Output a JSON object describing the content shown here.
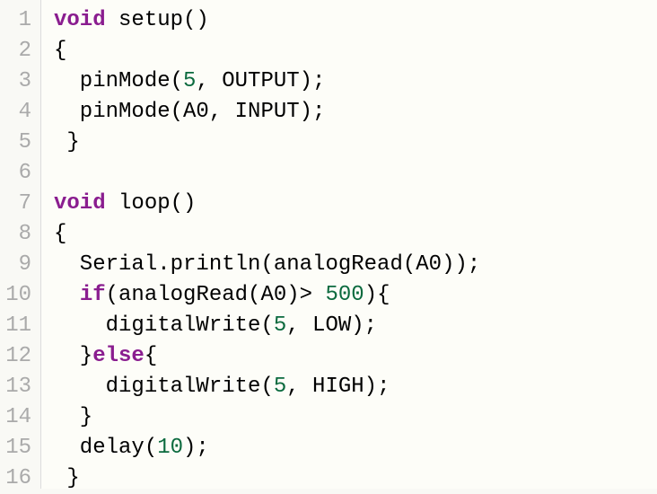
{
  "code": {
    "lines": [
      {
        "num": "1",
        "tokens": [
          {
            "t": "kw",
            "v": "void"
          },
          {
            "t": "plain",
            "v": " setup()"
          }
        ]
      },
      {
        "num": "2",
        "tokens": [
          {
            "t": "plain",
            "v": "{"
          }
        ]
      },
      {
        "num": "3",
        "tokens": [
          {
            "t": "plain",
            "v": "  pinMode("
          },
          {
            "t": "num",
            "v": "5"
          },
          {
            "t": "plain",
            "v": ", OUTPUT);"
          }
        ]
      },
      {
        "num": "4",
        "tokens": [
          {
            "t": "plain",
            "v": "  pinMode(A0, INPUT);"
          }
        ]
      },
      {
        "num": "5",
        "tokens": [
          {
            "t": "plain",
            "v": " }"
          }
        ]
      },
      {
        "num": "6",
        "tokens": [
          {
            "t": "plain",
            "v": ""
          }
        ]
      },
      {
        "num": "7",
        "tokens": [
          {
            "t": "kw",
            "v": "void"
          },
          {
            "t": "plain",
            "v": " loop()"
          }
        ]
      },
      {
        "num": "8",
        "tokens": [
          {
            "t": "plain",
            "v": "{"
          }
        ]
      },
      {
        "num": "9",
        "tokens": [
          {
            "t": "plain",
            "v": "  Serial.println(analogRead(A0));"
          }
        ]
      },
      {
        "num": "10",
        "tokens": [
          {
            "t": "plain",
            "v": "  "
          },
          {
            "t": "kw",
            "v": "if"
          },
          {
            "t": "plain",
            "v": "(analogRead(A0)> "
          },
          {
            "t": "num",
            "v": "500"
          },
          {
            "t": "plain",
            "v": "){"
          }
        ]
      },
      {
        "num": "11",
        "tokens": [
          {
            "t": "plain",
            "v": "    digitalWrite("
          },
          {
            "t": "num",
            "v": "5"
          },
          {
            "t": "plain",
            "v": ", LOW);"
          }
        ]
      },
      {
        "num": "12",
        "tokens": [
          {
            "t": "plain",
            "v": "  }"
          },
          {
            "t": "kw",
            "v": "else"
          },
          {
            "t": "plain",
            "v": "{"
          }
        ]
      },
      {
        "num": "13",
        "tokens": [
          {
            "t": "plain",
            "v": "    digitalWrite("
          },
          {
            "t": "num",
            "v": "5"
          },
          {
            "t": "plain",
            "v": ", HIGH);"
          }
        ]
      },
      {
        "num": "14",
        "tokens": [
          {
            "t": "plain",
            "v": "  }"
          }
        ]
      },
      {
        "num": "15",
        "tokens": [
          {
            "t": "plain",
            "v": "  delay("
          },
          {
            "t": "num",
            "v": "10"
          },
          {
            "t": "plain",
            "v": ");"
          }
        ]
      },
      {
        "num": "16",
        "tokens": [
          {
            "t": "plain",
            "v": " }"
          }
        ]
      }
    ]
  }
}
